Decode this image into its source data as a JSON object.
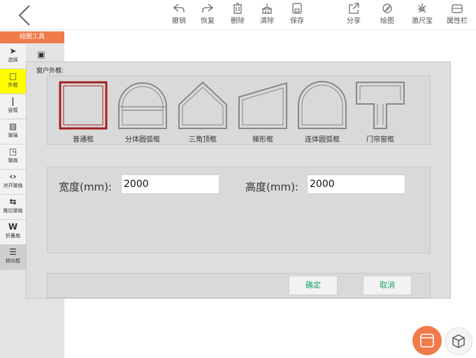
{
  "toolbar": {
    "undo": "撤销",
    "redo": "恢复",
    "delete": "删除",
    "clear": "清除",
    "save": "保存",
    "share": "分享",
    "draw": "绘图",
    "laser": "激尺宝",
    "props": "属性栏"
  },
  "sidebar": {
    "title": "绘图工具",
    "tools": [
      {
        "label": "选择",
        "icon": "pointer-icon"
      },
      {
        "label": "外框",
        "icon": "square-icon"
      },
      {
        "label": "竖框",
        "icon": "vertical-bar-icon"
      },
      {
        "label": "玻璃",
        "icon": "glass-icon"
      },
      {
        "label": "玻扇",
        "icon": "sash-icon"
      },
      {
        "label": "对开玻扇",
        "icon": "double-arrow-icon"
      },
      {
        "label": "推拉玻扇",
        "icon": "sliding-icon"
      },
      {
        "label": "折叠扇",
        "icon": "fold-icon"
      },
      {
        "label": "转向框",
        "icon": "turn-frame-icon"
      }
    ]
  },
  "dialog": {
    "title": "窗户外框:",
    "frames": [
      {
        "label": "普通框",
        "selected": true
      },
      {
        "label": "分体圆弧框",
        "selected": false
      },
      {
        "label": "三角顶框",
        "selected": false
      },
      {
        "label": "梯形框",
        "selected": false
      },
      {
        "label": "连体圆弧框",
        "selected": false
      },
      {
        "label": "门帘窗框",
        "selected": false
      }
    ],
    "width_label": "宽度(mm):",
    "width_value": "2000",
    "height_label": "高度(mm):",
    "height_value": "2000",
    "ok": "确定",
    "cancel": "取消"
  },
  "colors": {
    "accent": "#f07a4a",
    "selected_frame": "#a31f1f",
    "button_text": "#19a35c",
    "active_tool": "#ffff00"
  }
}
